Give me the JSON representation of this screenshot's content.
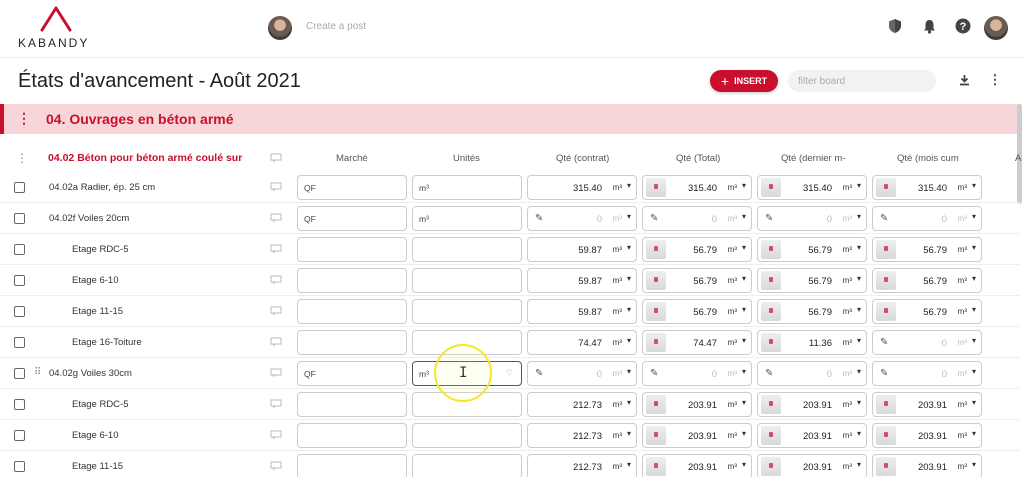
{
  "app": {
    "logo_text": "KABANDY"
  },
  "topbar": {
    "create_post_placeholder": "Create a post",
    "icons": [
      "shield-icon",
      "bell-icon",
      "help-icon",
      "avatar"
    ]
  },
  "page": {
    "title": "États d'avancement - Août 2021",
    "insert_label": "INSERT",
    "filter_placeholder": "filter board"
  },
  "section": {
    "title": "04. Ouvrages en béton armé"
  },
  "table": {
    "group_title": "04.02 Béton pour béton armé coulé sur",
    "columns": [
      "Marché",
      "Unités",
      "Qté (contrat)",
      "Qté (Total)",
      "Qté (dernier m-",
      "Qté (mois cum"
    ],
    "extra_column_stub": "A",
    "rows": [
      {
        "label": "04.02a Radier, ép. 25 cm",
        "marche": "QF",
        "unite": "m³",
        "qte_contrat": "315.40",
        "qte_total": "315.40",
        "qte_dernier": "315.40",
        "qte_mois": "315.40",
        "unit": "m³"
      },
      {
        "label": "04.02f Voiles 20cm",
        "marche": "QF",
        "unite": "m³",
        "qte_contrat": "0",
        "qte_total": "0",
        "qte_dernier": "0",
        "qte_mois": "0",
        "unit": "m³"
      },
      {
        "label": "Etage RDC-5",
        "marche": "",
        "unite": "",
        "qte_contrat": "59.87",
        "qte_total": "56.79",
        "qte_dernier": "56.79",
        "qte_mois": "56.79",
        "unit": "m³"
      },
      {
        "label": "Etage 6-10",
        "marche": "",
        "unite": "",
        "qte_contrat": "59.87",
        "qte_total": "56.79",
        "qte_dernier": "56.79",
        "qte_mois": "56.79",
        "unit": "m³"
      },
      {
        "label": "Etage 11-15",
        "marche": "",
        "unite": "",
        "qte_contrat": "59.87",
        "qte_total": "56.79",
        "qte_dernier": "56.79",
        "qte_mois": "56.79",
        "unit": "m³"
      },
      {
        "label": "Etage 16-Toiture",
        "marche": "",
        "unite": "",
        "qte_contrat": "74.47",
        "qte_total": "74.47",
        "qte_dernier": "11.36",
        "qte_mois": "0",
        "unit": "m³"
      },
      {
        "label": "04.02g Voiles 30cm",
        "marche": "QF",
        "unite": "m³",
        "qte_contrat": "0",
        "qte_total": "0",
        "qte_dernier": "0",
        "qte_mois": "0",
        "unit": "m³"
      },
      {
        "label": "Etage RDC-5",
        "marche": "",
        "unite": "",
        "qte_contrat": "212.73",
        "qte_total": "203.91",
        "qte_dernier": "203.91",
        "qte_mois": "203.91",
        "unit": "m³"
      },
      {
        "label": "Etage 6-10",
        "marche": "",
        "unite": "",
        "qte_contrat": "212.73",
        "qte_total": "203.91",
        "qte_dernier": "203.91",
        "qte_mois": "203.91",
        "unit": "m³"
      },
      {
        "label": "Etage 11-15",
        "marche": "",
        "unite": "",
        "qte_contrat": "212.73",
        "qte_total": "203.91",
        "qte_dernier": "203.91",
        "qte_mois": "203.91",
        "unit": "m³"
      }
    ]
  },
  "colors": {
    "brand": "#c8102e",
    "section_bg": "#f6d6d8",
    "cursor_highlight": "#f3e82a"
  }
}
